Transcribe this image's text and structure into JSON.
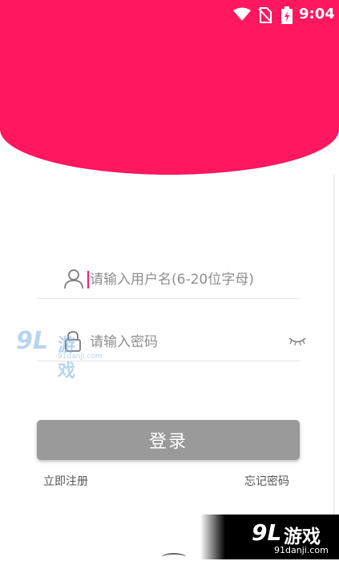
{
  "status_bar": {
    "time": "9:04",
    "icons": [
      "wifi-icon",
      "no-sim-icon",
      "battery-charging-icon"
    ]
  },
  "colors": {
    "accent": "#ff1760",
    "button_disabled": "#9a9a9a",
    "placeholder": "#8f8f8f"
  },
  "form": {
    "username": {
      "placeholder": "请输入用户名(6-20位字母)",
      "value": "",
      "icon": "user-icon"
    },
    "password": {
      "placeholder": "请输入密码",
      "value": "",
      "icon": "lock-icon",
      "toggle_icon": "eye-closed-icon"
    },
    "login_label": "登录",
    "register_label": "立即注册",
    "forgot_label": "忘记密码"
  },
  "watermark": {
    "logo_num": "9L",
    "logo_text": "游戏",
    "logo_url": "91danji.com"
  }
}
